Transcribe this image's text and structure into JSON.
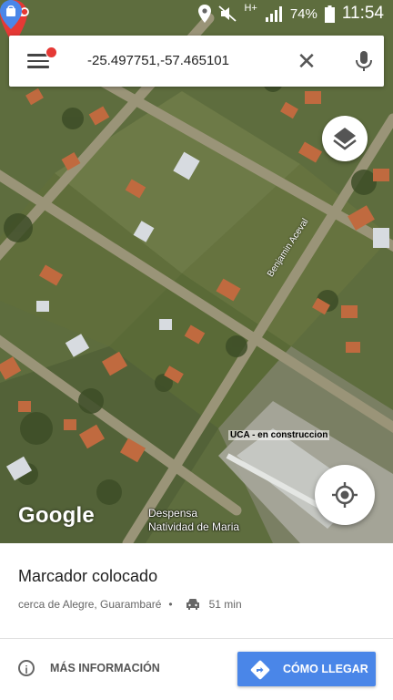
{
  "status_bar": {
    "left_icon": "voicemail-icon",
    "icons": [
      "location-icon",
      "mute-icon",
      "hplus-signal-icon",
      "battery-icon"
    ],
    "network": "H+",
    "battery": "74%",
    "time": "11:54"
  },
  "search": {
    "value": "-25.497751,-57.465101",
    "menu_icon": "hamburger-menu-icon",
    "close_icon": "close-icon",
    "mic_icon": "microphone-icon"
  },
  "map": {
    "street_label": "Benjamin Aceval",
    "overlay_label": "UCA - en construccion",
    "google_logo": "Google",
    "poi_label_line1": "Despensa",
    "poi_label_line2": "Natividad de Maria",
    "marker_color": "#e53935"
  },
  "place": {
    "title": "Marcador colocado",
    "location": "cerca de Alegre, Guarambaré",
    "travel_time": "51 min",
    "travel_icon": "car-icon"
  },
  "actions": {
    "more_info_label": "MÁS INFORMACIÓN",
    "directions_label": "CÓMO LLEGAR",
    "accent": "#4a86e8"
  }
}
